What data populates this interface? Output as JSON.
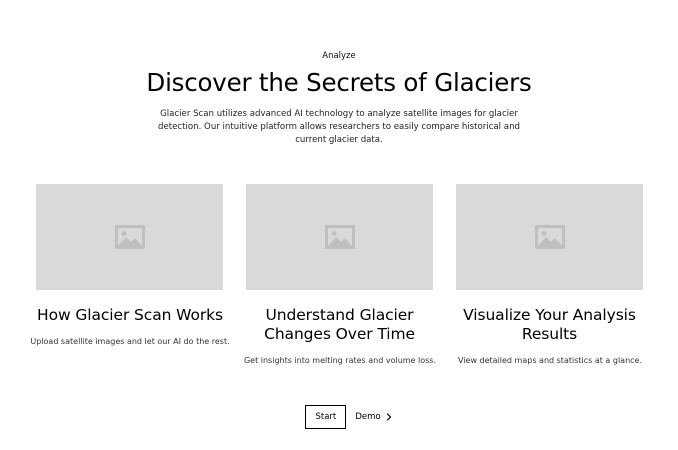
{
  "header": {
    "tagline": "Analyze",
    "title": "Discover the Secrets of Glaciers",
    "description": "Glacier Scan utilizes advanced AI technology to analyze satellite images for glacier detection. Our intuitive platform allows researchers to easily compare historical and current glacier data."
  },
  "cards": [
    {
      "image_icon": "image-placeholder-icon",
      "title": "How Glacier Scan Works",
      "text": "Upload satellite images and let our AI do the rest."
    },
    {
      "image_icon": "image-placeholder-icon",
      "title": "Understand Glacier Changes Over Time",
      "text": "Get insights into melting rates and volume loss."
    },
    {
      "image_icon": "image-placeholder-icon",
      "title": "Visualize Your Analysis Results",
      "text": "View detailed maps and statistics at a glance."
    }
  ],
  "actions": {
    "start_label": "Start",
    "demo_label": "Demo",
    "demo_icon": "chevron-right-icon"
  },
  "colors": {
    "placeholder_bg": "#d9d9d9",
    "placeholder_icon": "#bfbfbf",
    "text": "#000000"
  }
}
